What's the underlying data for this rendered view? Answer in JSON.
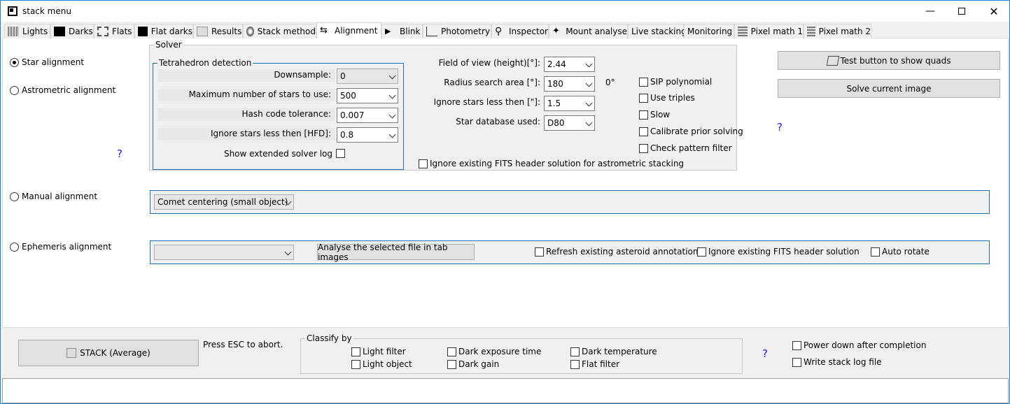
{
  "window": {
    "title": "stack menu"
  },
  "tabs": [
    {
      "label": "Lights",
      "icon": "lights-icon"
    },
    {
      "label": "Darks",
      "icon": "darks-icon"
    },
    {
      "label": "Flats",
      "icon": "flats-icon"
    },
    {
      "label": "Flat darks",
      "icon": "flat-darks-icon"
    },
    {
      "label": "Results",
      "icon": "results-icon"
    },
    {
      "label": "Stack method",
      "icon": "stack-method-icon"
    },
    {
      "label": "Alignment",
      "icon": "alignment-icon"
    },
    {
      "label": "Blink",
      "icon": "blink-icon"
    },
    {
      "label": "Photometry",
      "icon": "photometry-icon"
    },
    {
      "label": "Inspector",
      "icon": "magnifier-icon"
    },
    {
      "label": "Mount analyse",
      "icon": "telescope-icon"
    },
    {
      "label": "Live stacking",
      "icon": ""
    },
    {
      "label": "Monitoring",
      "icon": ""
    },
    {
      "label": "Pixel math 1",
      "icon": "pixel-math-icon"
    },
    {
      "label": "Pixel math 2",
      "icon": "pixel-math-icon"
    }
  ],
  "alignment": {
    "star_alignment": "Star alignment",
    "astrometric_alignment": "Astrometric alignment",
    "manual_alignment": "Manual alignment",
    "ephemeris_alignment": "Ephemeris alignment",
    "help_mark": "?"
  },
  "solver": {
    "legend": "Solver",
    "tetra_legend": "Tetrahedron detection",
    "downsample_label": "Downsample:",
    "downsample_value": "0",
    "max_stars_label": "Maximum number of stars to use:",
    "max_stars_value": "500",
    "hash_label": "Hash code tolerance:",
    "hash_value": "0.007",
    "ignore_hfd_label": "Ignore stars less then [HFD]:",
    "ignore_hfd_value": "0.8",
    "extended_log_label": "Show extended solver log",
    "fov_label": "Field of view (height)[°]:",
    "fov_value": "2.44",
    "radius_label": "Radius search area  [°]:",
    "radius_value": "180",
    "radius_unit": "0°",
    "ignore_arcsec_label": "Ignore stars less then [\"]:",
    "ignore_arcsec_value": "1.5",
    "database_label": "Star database used:",
    "database_value": "D80",
    "sip": "SIP polynomial",
    "triples": "Use triples",
    "slow": "Slow",
    "calibrate": "Calibrate prior solving",
    "check_pattern": "Check pattern filter",
    "ignore_fits": "Ignore existing FITS header solution for astrometric stacking"
  },
  "buttons": {
    "test_quads": "Test button to show quads",
    "solve_current": "Solve current image"
  },
  "manual": {
    "mode": "Comet centering (small object)"
  },
  "ephemeris": {
    "select_value": "",
    "analyse": "Analyse the selected file in tab images",
    "refresh": "Refresh existing asteroid annotations",
    "ignore_fits": "Ignore existing FITS header solution",
    "auto_rotate": "Auto rotate"
  },
  "bottom": {
    "stack_button": "STACK (Average)",
    "esc_text": "Press ESC to abort.",
    "classify_legend": "Classify by",
    "light_filter": "Light filter",
    "light_object": "Light object",
    "dark_exposure": "Dark exposure time",
    "dark_gain": "Dark gain",
    "dark_temp": "Dark temperature",
    "flat_filter": "Flat filter",
    "help_mark": "?",
    "power_down": "Power down after completion",
    "write_log": "Write stack log file"
  },
  "colors": {
    "accent": "#1883d7",
    "help": "#1a1aff",
    "group_border": "#1e6fb7"
  }
}
